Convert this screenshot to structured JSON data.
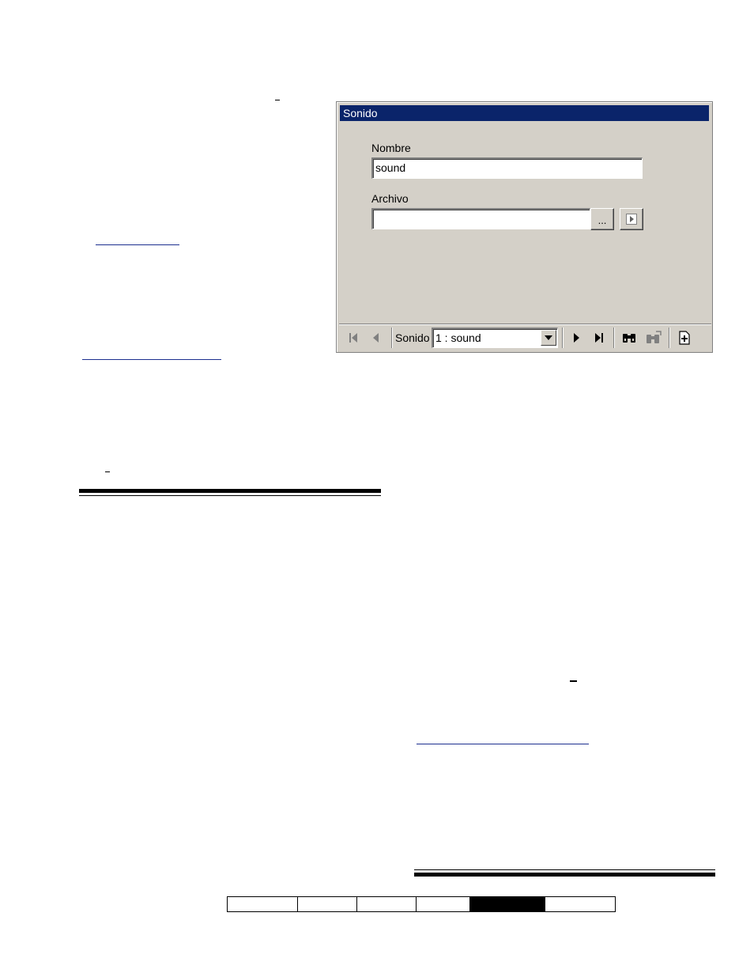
{
  "dialog": {
    "title": "Sonido",
    "name_label": "Nombre",
    "name_value": "sound",
    "file_label": "Archivo",
    "file_value": "",
    "browse_label": "...",
    "navigator": {
      "record_label": "Sonido",
      "selected_record": "1 : sound"
    }
  },
  "icons": {
    "first": "first-record-icon",
    "prev": "previous-record-icon",
    "next": "next-record-icon",
    "last": "last-record-icon",
    "find": "binoculars-icon",
    "find_next": "find-next-icon",
    "new": "new-record-icon",
    "play": "play-icon",
    "dropdown": "chevron-down-icon"
  },
  "colors": {
    "titlebar": "#0a246a",
    "panel": "#d4d0c8",
    "link": "#1c2f8f"
  },
  "footer_tabs": [
    "",
    "",
    "",
    "",
    "",
    ""
  ]
}
